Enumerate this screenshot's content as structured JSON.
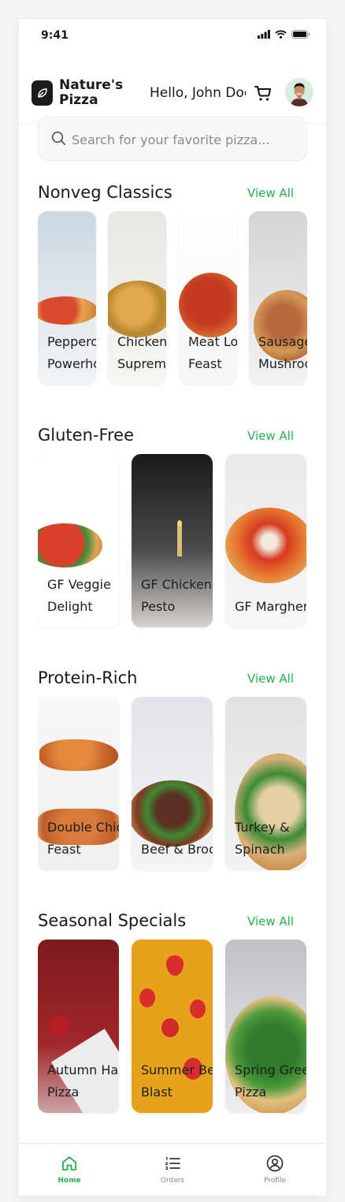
{
  "status_bar": {
    "time": "9:41"
  },
  "header": {
    "brand_line1": "Nature's",
    "brand_line2": "Pizza",
    "greeting": "Hello, John Doe"
  },
  "search": {
    "placeholder": "Search for your favorite pizza..."
  },
  "sections": [
    {
      "title": "Nonveg Classics",
      "view_all": "View All",
      "items": [
        "Pepperoni Powerhouse",
        "Chicken Supreme",
        "Meat Lover's Feast",
        "Sausage Mushroom"
      ]
    },
    {
      "title": "Gluten-Free",
      "view_all": "View All",
      "items": [
        "GF Veggie Delight",
        "GF Chicken Pesto",
        "GF Margherita"
      ]
    },
    {
      "title": "Protein-Rich",
      "view_all": "View All",
      "items": [
        "Double Chicken Feast",
        "Beef & Broccoli",
        "Turkey & Spinach"
      ]
    },
    {
      "title": "Seasonal Specials",
      "view_all": "View All",
      "items": [
        "Autumn Harvest Pizza",
        "Summer Berry Blast",
        "Spring Greens Pizza"
      ]
    }
  ],
  "nav": {
    "home": "Home",
    "orders": "Orders",
    "profile": "Profile"
  },
  "colors": {
    "accent": "#22b24c",
    "text": "#1a1a1a"
  }
}
